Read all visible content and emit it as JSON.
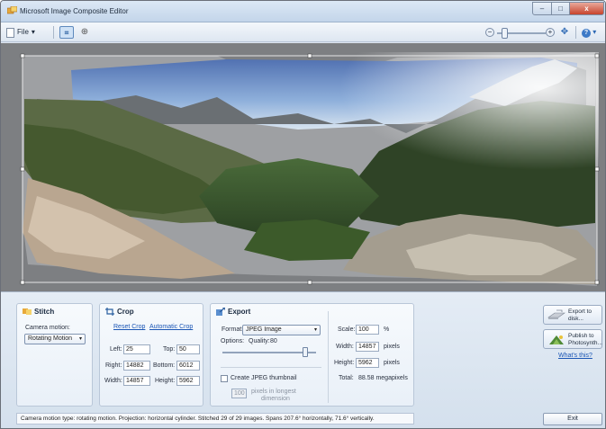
{
  "window": {
    "title": "Microsoft Image Composite Editor",
    "min_glyph": "–",
    "max_glyph": "□",
    "close_glyph": "x"
  },
  "toolbar": {
    "file_label": "File",
    "file_arrow": "▾",
    "crop_glyph": "⌗",
    "globe_glyph": "⊕",
    "zoom_minus": "−",
    "zoom_plus": "+",
    "zoom_level": 0.1,
    "pan_glyph": "✥",
    "help_glyph": "?",
    "help_arrow": "▾"
  },
  "stitch": {
    "title": "Stitch",
    "camera_motion_label": "Camera motion:",
    "camera_motion_value": "Rotating Motion",
    "select_arrow": "▾"
  },
  "crop": {
    "title": "Crop",
    "reset_link": "Reset Crop",
    "auto_link": "Automatic Crop",
    "left_label": "Left:",
    "left_value": "25",
    "top_label": "Top:",
    "top_value": "50",
    "right_label": "Right:",
    "right_value": "14882",
    "bottom_label": "Bottom:",
    "bottom_value": "6012",
    "width_label": "Width:",
    "width_value": "14857",
    "height_label": "Height:",
    "height_value": "5962"
  },
  "export": {
    "title": "Export",
    "format_label": "Format:",
    "format_value": "JPEG Image",
    "select_arrow": "▾",
    "options_label": "Options:",
    "quality_label": "Quality:",
    "quality_value": "80",
    "thumbnail_label": "Create JPEG thumbnail",
    "thumbnail_checked": false,
    "thumb_size_value": "100",
    "thumb_size_text_1": "pixels in longest",
    "thumb_size_text_2": "dimension",
    "scale_label": "Scale:",
    "scale_value": "100",
    "scale_unit": "%",
    "width_label": "Width:",
    "width_value": "14857",
    "width_unit": "pixels",
    "height_label": "Height:",
    "height_value": "5962",
    "height_unit": "pixels",
    "total_label": "Total:",
    "total_value": "88.58 megapixels"
  },
  "side_actions": {
    "export_disk_line1": "Export to",
    "export_disk_line2": "disk...",
    "publish_line1": "Publish to",
    "publish_line2": "Photosynth...",
    "whats_this": "What's this?"
  },
  "status": {
    "text": "Camera motion type: rotating motion. Projection: horizontal cylinder. Stitched 29 of 29 images. Spans 207.6° horizontally, 71.6° vertically."
  },
  "footer": {
    "exit_label": "Exit"
  },
  "colors": {
    "canvas_bg": "#7d7f82",
    "panel_bg": "#dfe8f2",
    "link": "#1b56b5",
    "close_red": "#c7432c"
  },
  "icons": {
    "app": "composite-editor-icon",
    "stitch": "stitch-icon",
    "crop": "crop-icon",
    "export": "export-icon",
    "export_disk": "export-disk-icon",
    "publish": "photosynth-icon"
  }
}
